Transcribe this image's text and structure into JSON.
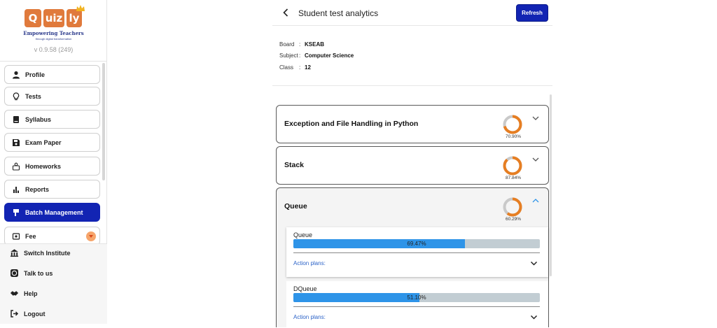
{
  "brand": {
    "logo_letters": [
      "Q",
      "uiz",
      "ly"
    ],
    "tagline": "Empowering Teachers",
    "subtagline": "through digital transformation",
    "version": "v 0.9.58 (249)"
  },
  "sidebar": {
    "items": [
      {
        "label": "Profile",
        "icon": "person-icon"
      },
      {
        "label": "Tests",
        "icon": "lightbulb-icon"
      },
      {
        "label": "Syllabus",
        "icon": "book-icon"
      },
      {
        "label": "Exam Paper",
        "icon": "save-icon"
      },
      {
        "label": "Homeworks",
        "icon": "homework-icon"
      },
      {
        "label": "Reports",
        "icon": "bar-chart-icon"
      },
      {
        "label": "Batch Management",
        "icon": "batch-icon",
        "active": true
      },
      {
        "label": "Fee",
        "icon": "fee-icon"
      }
    ],
    "bottom_items": [
      {
        "label": "Switch Institute",
        "icon": "institute-icon"
      },
      {
        "label": "Talk to us",
        "icon": "whatsapp-icon"
      },
      {
        "label": "Help",
        "icon": "handshake-icon"
      },
      {
        "label": "Logout",
        "icon": "logout-icon"
      }
    ]
  },
  "header": {
    "title": "Student test analytics",
    "refresh_label": "Refresh"
  },
  "info": {
    "board_label": "Board",
    "board_value": "KSEAB",
    "subject_label": "Subject",
    "subject_value": "Computer Science",
    "class_label": "Class",
    "class_value": "12",
    "separator": ":"
  },
  "chapters": [
    {
      "title": "Exception and File Handling in Python",
      "percent": 70.9,
      "percent_label": "70.90%",
      "expanded": false
    },
    {
      "title": "Stack",
      "percent": 87.84,
      "percent_label": "87.84%",
      "expanded": false
    },
    {
      "title": "Queue",
      "percent": 60.29,
      "percent_label": "60.29%",
      "expanded": true
    }
  ],
  "topics": [
    {
      "name": "Queue",
      "percent": 69.47,
      "percent_label": "69.47%",
      "action_label": "Action plans:"
    },
    {
      "name": "DQueue",
      "percent": 51.1,
      "percent_label": "51.10%",
      "action_label": "Action plans:"
    }
  ],
  "colors": {
    "primary": "#1224b3",
    "ring_progress": "#e67e22",
    "ring_track": "#c9c9c9",
    "bar_fill": "#2e94e8",
    "bar_track": "#c2cdd3",
    "link": "#2c63c8",
    "logo_orange": "#e07a3c"
  }
}
